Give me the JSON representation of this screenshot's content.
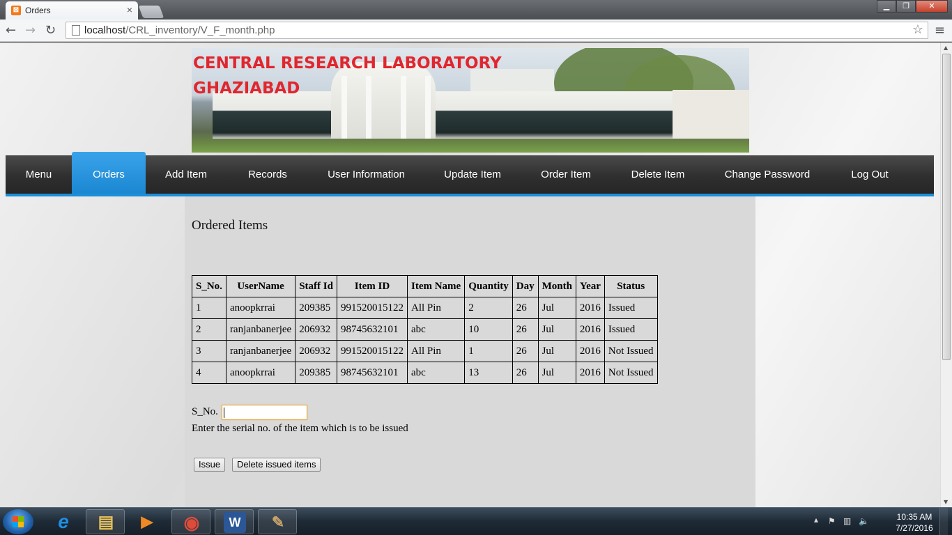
{
  "browser": {
    "tab_title": "Orders",
    "tab_close": "×",
    "url_host": "localhost",
    "url_path": "/CRL_inventory/V_F_month.php",
    "icons": [
      "back-icon",
      "forward-icon",
      "reload-icon",
      "page-icon",
      "star-icon",
      "menu-icon"
    ]
  },
  "window_controls": {
    "minimize": "▁",
    "maximize": "❐",
    "close": "✕"
  },
  "banner": {
    "line1": "CENTRAL RESEARCH LABORATORY",
    "line2": "GHAZIABAD"
  },
  "nav": {
    "items": [
      {
        "label": "Menu"
      },
      {
        "label": "Orders",
        "active": true
      },
      {
        "label": "Add Item"
      },
      {
        "label": "Records"
      },
      {
        "label": "User Information"
      },
      {
        "label": "Update Item"
      },
      {
        "label": "Order Item"
      },
      {
        "label": "Delete Item"
      },
      {
        "label": "Change Password"
      },
      {
        "label": "Log Out"
      }
    ],
    "accent": "#1b8fd8"
  },
  "main": {
    "heading": "Ordered Items",
    "table": {
      "columns": [
        "S_No.",
        "UserName",
        "Staff Id",
        "Item ID",
        "Item Name",
        "Quantity",
        "Day",
        "Month",
        "Year",
        "Status"
      ],
      "rows": [
        [
          "1",
          "anoopkrrai",
          "209385",
          "991520015122",
          "All Pin",
          "2",
          "26",
          "Jul",
          "2016",
          "Issued"
        ],
        [
          "2",
          "ranjanbanerjee",
          "206932",
          "98745632101",
          "abc",
          "10",
          "26",
          "Jul",
          "2016",
          "Issued"
        ],
        [
          "3",
          "ranjanbanerjee",
          "206932",
          "991520015122",
          "All Pin",
          "1",
          "26",
          "Jul",
          "2016",
          "Not Issued"
        ],
        [
          "4",
          "anoopkrrai",
          "209385",
          "98745632101",
          "abc",
          "13",
          "26",
          "Jul",
          "2016",
          "Not Issued"
        ]
      ]
    },
    "sno_label": "S_No.",
    "sno_value": "",
    "hint": "Enter the serial no. of the item which is to be issued",
    "issue_button": "Issue",
    "delete_button": "Delete issued items"
  },
  "taskbar": {
    "apps": [
      {
        "name": "ie-icon",
        "glyph": "e",
        "color": "#1e8fe0"
      },
      {
        "name": "explorer-icon",
        "glyph": "▤",
        "color": "#e8c25a"
      },
      {
        "name": "media-player-icon",
        "glyph": "▶",
        "color": "#f08a24"
      },
      {
        "name": "chrome-icon",
        "glyph": "◉",
        "color": "#dd4b39"
      },
      {
        "name": "word-icon",
        "glyph": "W",
        "color": "#2b5797"
      },
      {
        "name": "paint-icon",
        "glyph": "✎",
        "color": "#c9a36a"
      }
    ],
    "time": "10:35 AM",
    "date": "7/27/2016"
  }
}
